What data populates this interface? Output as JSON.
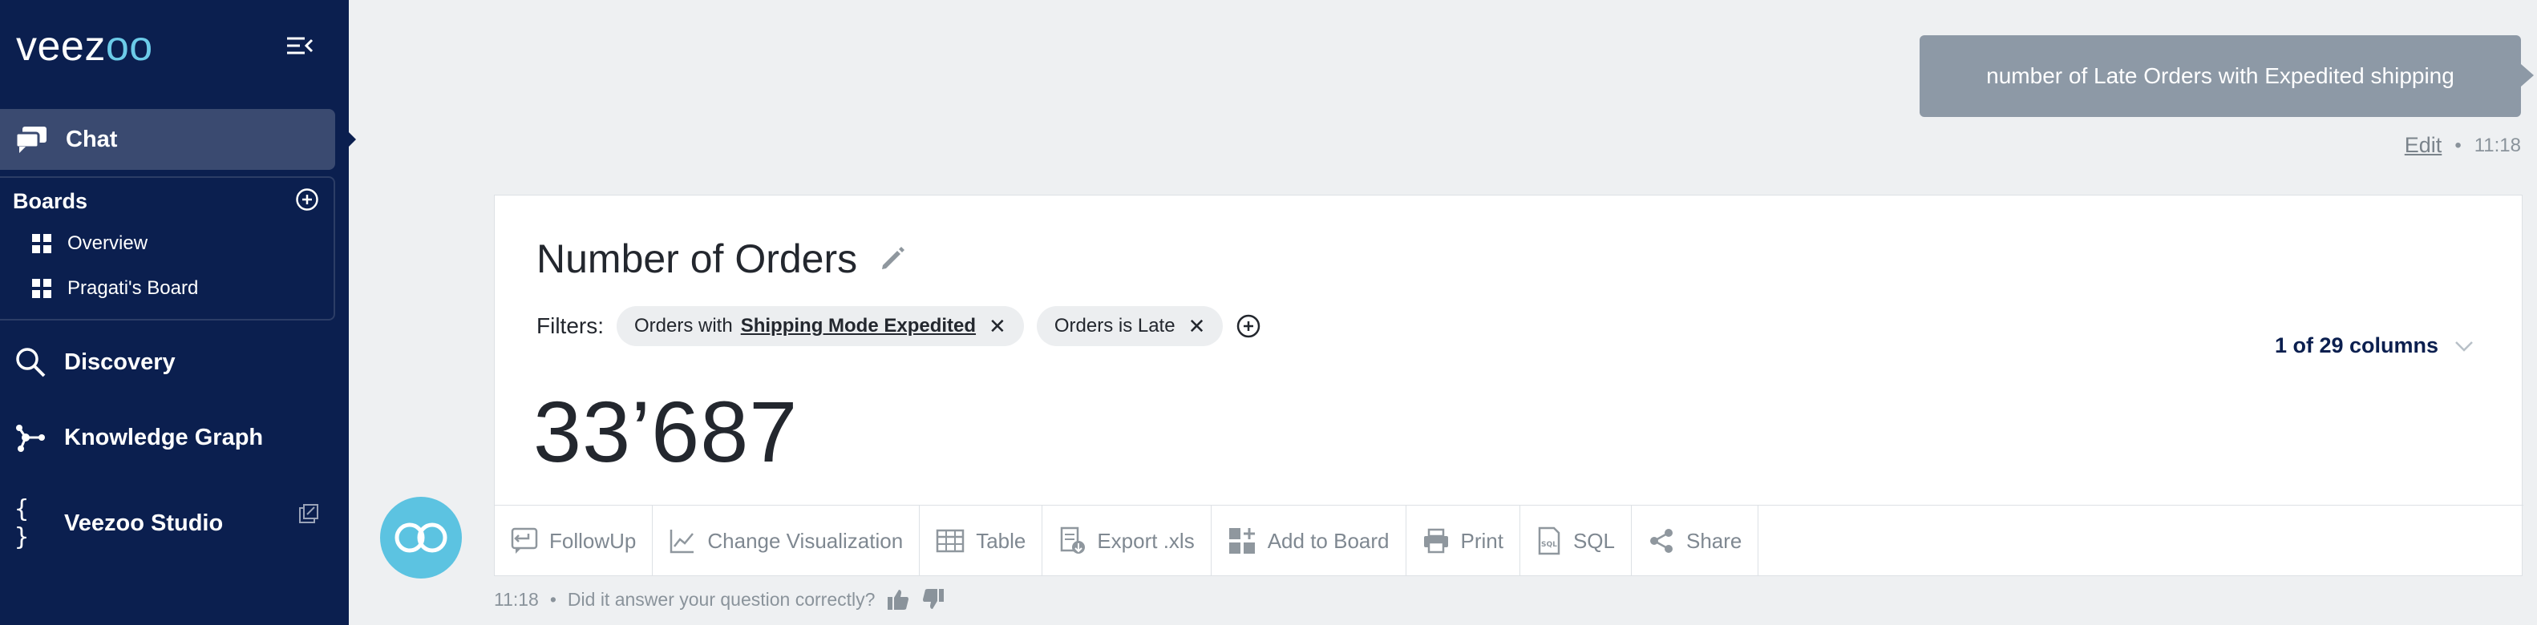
{
  "app": {
    "logo_main": "veez",
    "logo_accent": "oo"
  },
  "sidebar": {
    "chat_label": "Chat",
    "boards_label": "Boards",
    "boards": [
      "Overview",
      "Pragati's Board"
    ],
    "discovery_label": "Discovery",
    "knowledge_graph_label": "Knowledge Graph",
    "studio_label": "Veezoo Studio"
  },
  "conversation": {
    "question": "number of Late Orders with Expedited shipping",
    "edit_label": "Edit",
    "question_time": "11:18",
    "answer_time": "11:18",
    "feedback_prompt": "Did it answer your question correctly?"
  },
  "answer": {
    "title": "Number of Orders",
    "filters_label": "Filters:",
    "filter1_prefix": "Orders with",
    "filter1_bold": "Shipping Mode Expedited",
    "filter2": "Orders is Late",
    "columns_info": "1 of 29 columns",
    "value": "33’687"
  },
  "toolbar": {
    "followup": "FollowUp",
    "change_viz": "Change Visualization",
    "table": "Table",
    "export": "Export .xls",
    "add_board": "Add to Board",
    "print": "Print",
    "sql": "SQL",
    "share": "Share"
  },
  "colors": {
    "sidebar": "#0b1f4f",
    "accent": "#5cc3e1",
    "bubble": "#8d99a6"
  }
}
